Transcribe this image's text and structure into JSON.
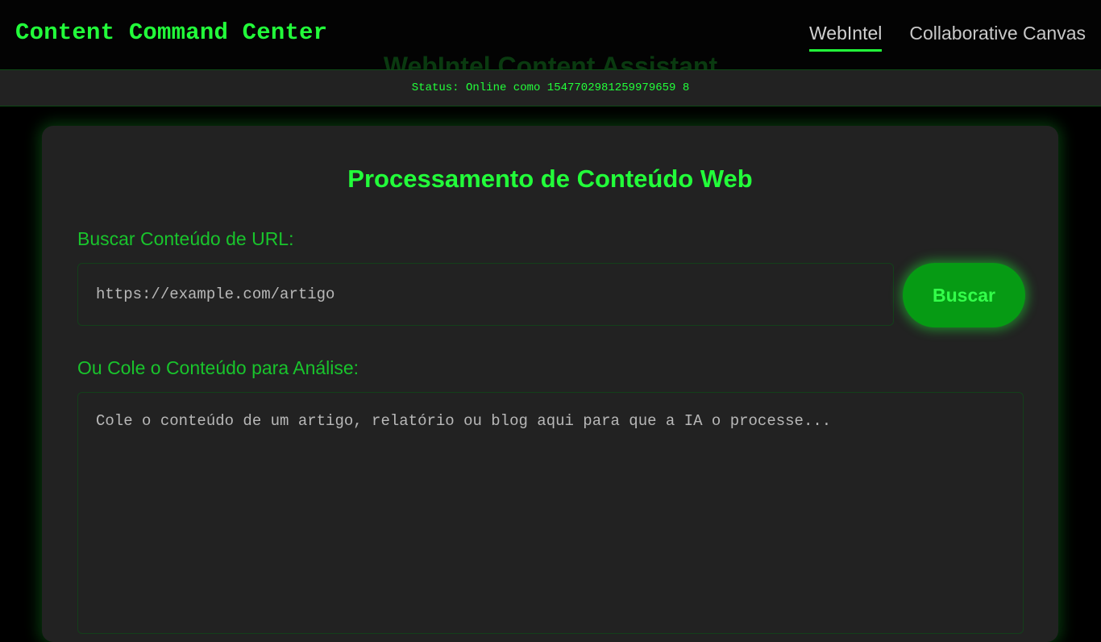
{
  "header": {
    "brand": "Content Command Center",
    "nav": [
      {
        "label": "WebIntel",
        "active": true
      },
      {
        "label": "Collaborative Canvas",
        "active": false
      }
    ],
    "ghost_title": "WebIntel Content Assistant"
  },
  "status": {
    "text": "Status: Online como 1547702981259979659 8"
  },
  "card": {
    "title": "Processamento de Conteúdo Web",
    "url_label": "Buscar Conteúdo de URL:",
    "url_placeholder": "https://example.com/artigo",
    "buscar_label": "Buscar",
    "content_label": "Ou Cole o Conteúdo para Análise:",
    "content_placeholder": "Cole o conteúdo de um artigo, relatório ou blog aqui para que a IA o processe..."
  },
  "colors": {
    "accent": "#22ff3a",
    "background": "#000000",
    "panel": "#222222",
    "button": "#069b14"
  }
}
